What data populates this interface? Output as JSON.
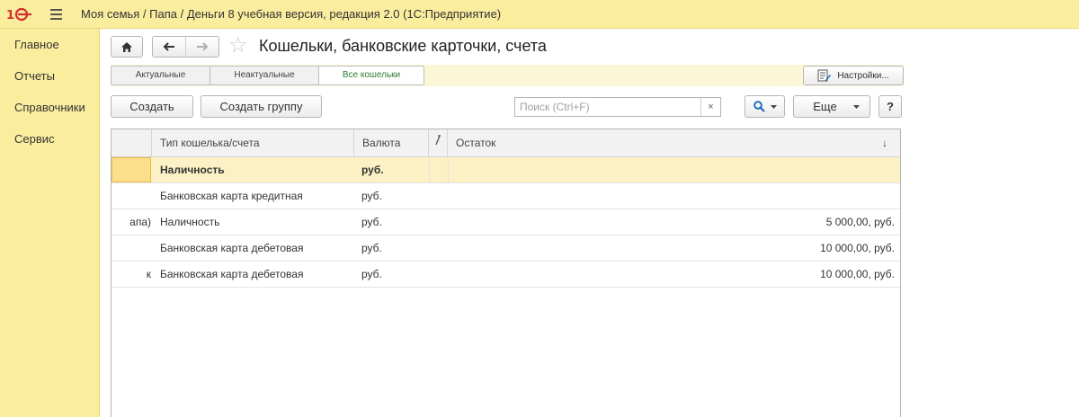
{
  "topbar": {
    "logo": "1С",
    "title": "Моя семья / Папа / Деньги 8 учебная версия, редакция 2.0  (1С:Предприятие)"
  },
  "sidebar": {
    "items": [
      "Главное",
      "Отчеты",
      "Справочники",
      "Сервис"
    ]
  },
  "page": {
    "title": "Кошельки, банковские карточки, счета"
  },
  "filters": {
    "tabs": [
      "Актуальные",
      "Неактуальные",
      "Все кошельки"
    ],
    "active_tab": "Все кошельки",
    "settings_label": "Настройки..."
  },
  "toolbar": {
    "create_label": "Создать",
    "create_group_label": "Создать группу",
    "search_placeholder": "Поиск (Ctrl+F)",
    "search_clear": "×",
    "more_label": "Еще",
    "help_label": "?"
  },
  "table": {
    "columns": [
      "Тип кошелька/счета",
      "Валюта",
      "",
      "Остаток"
    ],
    "sort_indicator": "↓",
    "rows": [
      {
        "name": "",
        "type": "Наличность",
        "currency": "руб.",
        "balance": "",
        "selected": true
      },
      {
        "name": "",
        "type": "Банковская карта кредитная",
        "currency": "руб.",
        "balance": ""
      },
      {
        "name": "апа)",
        "type": "Наличность",
        "currency": "руб.",
        "balance": "5 000,00, руб."
      },
      {
        "name": "",
        "type": "Банковская карта дебетовая",
        "currency": "руб.",
        "balance": "10 000,00, руб."
      },
      {
        "name": "к",
        "type": "Банковская карта дебетовая",
        "currency": "руб.",
        "balance": "10 000,00, руб."
      }
    ]
  },
  "colors": {
    "panel_yellow": "#fbed9e",
    "selected_row": "#fcf1c4",
    "active_tab_text": "#2e7d32",
    "search_icon": "#1565c0"
  },
  "icons": {
    "home": "home-icon",
    "back": "arrow-left-icon",
    "forward": "arrow-right-icon",
    "favorite": "star-icon",
    "settings": "settings-document-icon",
    "search": "magnifier-icon",
    "menu": "hamburger-menu-icon"
  }
}
